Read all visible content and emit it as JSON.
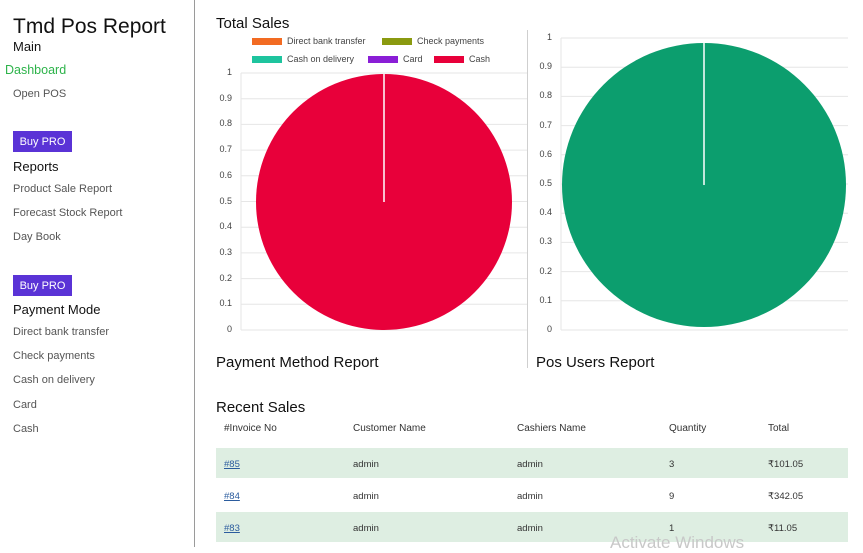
{
  "sidebar": {
    "title": "Tmd Pos Report",
    "main_label": "Main",
    "dashboard": "Dashboard",
    "open_pos": "Open POS",
    "buy_pro_1": "Buy PRO",
    "reports_label": "Reports",
    "reports": [
      "Product Sale Report",
      "Forecast Stock Report",
      "Day Book"
    ],
    "buy_pro_2": "Buy PRO",
    "payment_label": "Payment Mode",
    "payments": [
      "Direct bank transfer",
      "Check payments",
      "Cash on delivery",
      "Card",
      "Cash"
    ]
  },
  "main": {
    "total_sales": "Total Sales",
    "payment_method_report": "Payment Method Report",
    "pos_users_report": "Pos Users Report",
    "recent_sales": "Recent Sales"
  },
  "chart_data": [
    {
      "type": "pie",
      "legend": [
        {
          "label": "Direct bank transfer",
          "color": "#f26b22"
        },
        {
          "label": "Check payments",
          "color": "#8a9a10"
        },
        {
          "label": "Cash on delivery",
          "color": "#1ec49e"
        },
        {
          "label": "Card",
          "color": "#8a1ed6"
        },
        {
          "label": "Cash",
          "color": "#e8003a"
        }
      ],
      "slices": [
        {
          "label": "Direct bank transfer",
          "value": 0
        },
        {
          "label": "Check payments",
          "value": 0
        },
        {
          "label": "Cash on delivery",
          "value": 0
        },
        {
          "label": "Card",
          "value": 0
        },
        {
          "label": "Cash",
          "value": 1
        }
      ],
      "y_ticks": [
        "1",
        "0.9",
        "0.8",
        "0.7",
        "0.6",
        "0.5",
        "0.4",
        "0.3",
        "0.2",
        "0.1",
        "0"
      ],
      "legend_position": "top"
    },
    {
      "type": "pie",
      "slices": [
        {
          "label": "",
          "value": 1,
          "color": "#0c9e6e"
        }
      ],
      "y_ticks": [
        "1",
        "0.9",
        "0.8",
        "0.7",
        "0.6",
        "0.5",
        "0.4",
        "0.3",
        "0.2",
        "0.1",
        "0"
      ]
    }
  ],
  "table": {
    "headers": [
      "#Invoice No",
      "Customer Name",
      "Cashiers Name",
      "Quantity",
      "Total"
    ],
    "rows": [
      {
        "invoice": "#85",
        "customer": "admin",
        "cashier": "admin",
        "quantity": "3",
        "total": "₹101.05"
      },
      {
        "invoice": "#84",
        "customer": "admin",
        "cashier": "admin",
        "quantity": "9",
        "total": "₹342.05"
      },
      {
        "invoice": "#83",
        "customer": "admin",
        "cashier": "admin",
        "quantity": "1",
        "total": "₹11.05"
      }
    ]
  },
  "watermark": "Activate Windows"
}
